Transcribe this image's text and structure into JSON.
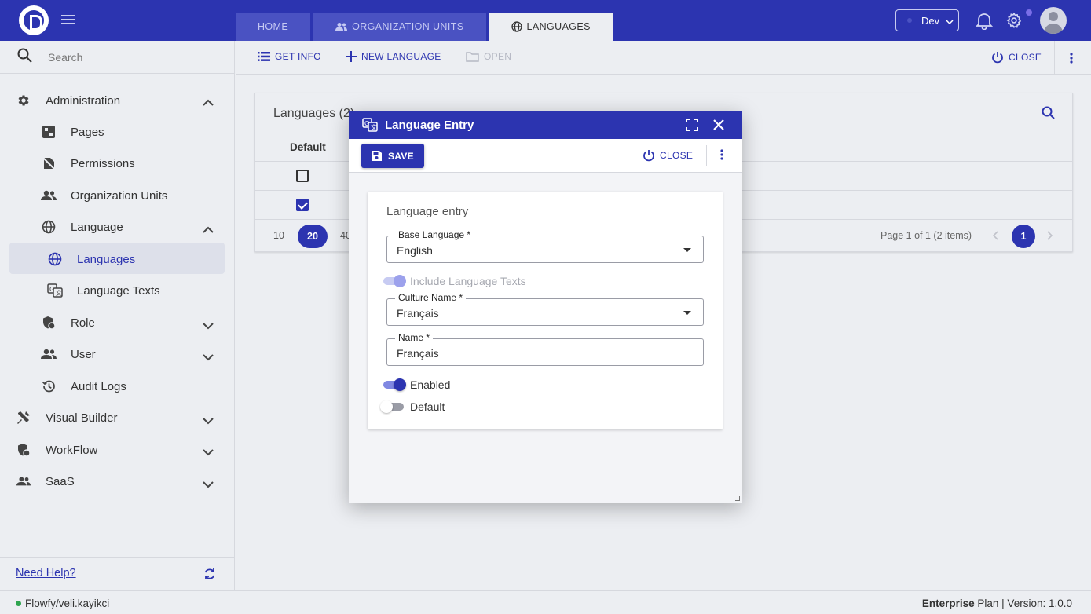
{
  "app": {
    "env_label": "Dev",
    "search_placeholder": "Search",
    "help_link": "Need Help?"
  },
  "tabs": [
    {
      "label": "HOME"
    },
    {
      "label": "ORGANIZATION UNITS"
    },
    {
      "label": "LANGUAGES"
    }
  ],
  "sidebar": {
    "items": [
      {
        "label": "Administration"
      },
      {
        "label": "Pages"
      },
      {
        "label": "Permissions"
      },
      {
        "label": "Organization Units"
      },
      {
        "label": "Language"
      },
      {
        "label": "Languages"
      },
      {
        "label": "Language Texts"
      },
      {
        "label": "Role"
      },
      {
        "label": "User"
      },
      {
        "label": "Audit Logs"
      },
      {
        "label": "Visual Builder"
      },
      {
        "label": "WorkFlow"
      },
      {
        "label": "SaaS"
      }
    ]
  },
  "toolbar": {
    "get_info": "GET INFO",
    "new_language": "NEW LANGUAGE",
    "open": "OPEN",
    "close": "CLOSE"
  },
  "grid": {
    "title": "Languages (2)",
    "header_default": "Default",
    "rows": [
      {
        "default": false
      },
      {
        "default": true
      }
    ],
    "page_sizes": [
      "10",
      "20",
      "40"
    ],
    "page_size_selected": "20",
    "page_info": "Page 1 of 1 (2 items)",
    "current_page": "1"
  },
  "dialog": {
    "title": "Language Entry",
    "save_label": "SAVE",
    "close_label": "CLOSE",
    "form_title": "Language entry",
    "base_language_label": "Base Language *",
    "base_language_value": "English",
    "include_texts_label": "Include Language Texts",
    "culture_name_label": "Culture Name *",
    "culture_name_value": "Français",
    "name_label": "Name *",
    "name_value": "Français",
    "enabled_label": "Enabled",
    "default_label": "Default"
  },
  "status": {
    "user": "Flowfy/veli.kayikci",
    "plan_bold": "Enterprise",
    "plan_rest": "Plan | Version: 1.0.0"
  },
  "colors": {
    "primary": "#2c34b0",
    "background": "#eceef2",
    "status_online": "#2ea44f"
  }
}
